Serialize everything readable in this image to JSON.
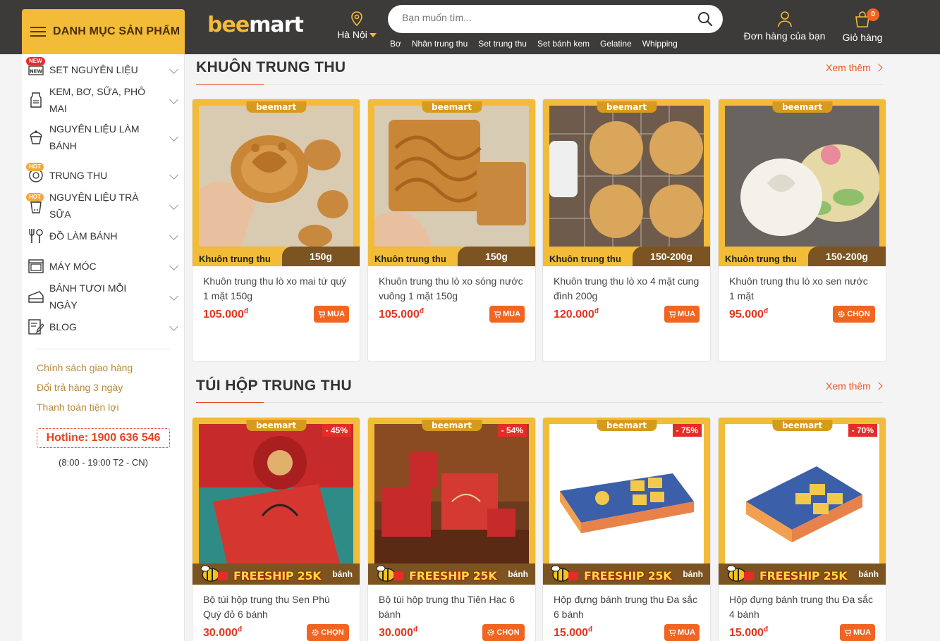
{
  "header": {
    "category_label": "DANH MỤC SẢN PHẨM",
    "logo": {
      "part1": "bee",
      "part2": "mart"
    },
    "location": "Hà Nội",
    "search_placeholder": "Bạn muốn tìm...",
    "quick_links": [
      "Bơ",
      "Nhân trung thu",
      "Set trung thu",
      "Set bánh kem",
      "Gelatine",
      "Whipping"
    ],
    "orders_label": "Đơn hàng của bạn",
    "cart_label": "Giỏ hàng",
    "cart_count": "0"
  },
  "sidebar": {
    "items": [
      {
        "label": "SET NGUYÊN LIỆU",
        "badge": "NEW",
        "icon": "new-icon"
      },
      {
        "label": "KEM, BƠ, SỮA, PHÔ MAI",
        "badge": "",
        "icon": "milk-icon"
      },
      {
        "label": "NGUYÊN LIỆU LÀM BÁNH",
        "badge": "",
        "icon": "cupcake-icon"
      },
      {
        "label": "TRUNG THU",
        "badge": "HOT",
        "icon": "mooncake-icon"
      },
      {
        "label": "NGUYÊN LIỆU TRÀ SỮA",
        "badge": "HOT",
        "icon": "milktea-icon"
      },
      {
        "label": "ĐỒ LÀM BÁNH",
        "badge": "",
        "icon": "utensils-icon"
      },
      {
        "label": "MÁY MÓC",
        "badge": "",
        "icon": "oven-icon"
      },
      {
        "label": "BÁNH TƯƠI MỖI NGÀY",
        "badge": "",
        "icon": "cake-icon"
      },
      {
        "label": "BLOG",
        "badge": "",
        "icon": "blog-icon"
      }
    ],
    "links": [
      "Chính sách giao hàng",
      "Đổi trả hàng 3 ngày",
      "Thanh toán tiện lợi"
    ],
    "hotline": "Hotline: 1900 636 546",
    "hours": "(8:00 - 19:00 T2 - CN)"
  },
  "sections": [
    {
      "title": "KHUÔN TRUNG THU",
      "more": "Xem thêm",
      "products": [
        {
          "name": "Khuôn trung thu lò xo mai tứ quý 1 mặt 150g",
          "price": "105.000",
          "currency": "đ",
          "tag": "beemart",
          "foot_left": "Khuôn trung thu",
          "foot_right": "150g",
          "action": "MUA"
        },
        {
          "name": "Khuôn trung thu lò xo sóng nước vuông 1 mặt 150g",
          "price": "105.000",
          "currency": "đ",
          "tag": "beemart",
          "foot_left": "Khuôn trung thu",
          "foot_right": "150g",
          "action": "MUA"
        },
        {
          "name": "Khuôn trung thu lò xo 4 mặt cung đình 200g",
          "price": "120.000",
          "currency": "đ",
          "tag": "beemart",
          "foot_left": "Khuôn trung thu",
          "foot_right": "150-200g",
          "action": "MUA"
        },
        {
          "name": "Khuôn trung thu lò xo sen nước 1 mặt",
          "price": "95.000",
          "currency": "đ",
          "tag": "beemart",
          "foot_left": "Khuôn trung thu",
          "foot_right": "150-200g",
          "action": "CHỌN"
        }
      ]
    },
    {
      "title": "TÚI HỘP TRUNG THU",
      "more": "Xem thêm",
      "products": [
        {
          "name": "Bộ túi hộp trung thu Sen Phú Quý đỏ 6 bánh",
          "price": "30.000",
          "currency": "đ",
          "tag": "beemart",
          "discount": "- 45%",
          "freeship": "FREESHIP 25K",
          "freeship_tail": "bánh",
          "action": "CHỌN"
        },
        {
          "name": "Bộ túi hộp trung thu Tiên Hạc 6 bánh",
          "price": "30.000",
          "currency": "đ",
          "tag": "beemart",
          "discount": "- 54%",
          "freeship": "FREESHIP 25K",
          "freeship_tail": "bánh",
          "action": "CHỌN"
        },
        {
          "name": "Hộp đựng bánh trung thu Đa sắc 6 bánh",
          "price": "15.000",
          "currency": "đ",
          "tag": "beemart",
          "discount": "- 75%",
          "freeship": "FREESHIP 25K",
          "freeship_tail": "bánh",
          "action": "MUA"
        },
        {
          "name": "Hộp đựng bánh trung thu Đa sắc 4 bánh",
          "price": "15.000",
          "currency": "đ",
          "tag": "beemart",
          "discount": "- 70%",
          "freeship": "FREESHIP 25K",
          "freeship_tail": "bánh",
          "action": "MUA"
        }
      ]
    }
  ],
  "colors": {
    "brand": "#f2bb38",
    "header_bg": "#3d3b39",
    "accent": "#f06522",
    "price": "#e5341e"
  }
}
